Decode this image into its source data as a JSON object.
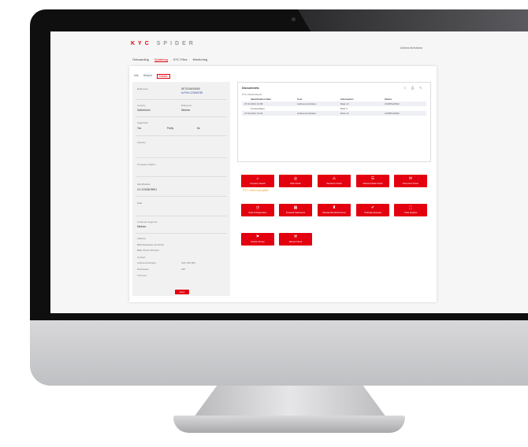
{
  "app": {
    "logo_a": "KYC",
    "logo_b": "SPIDER",
    "user": "Andrea Amistrana"
  },
  "nav": [
    "Onboarding",
    "Spidering",
    "KYC Files",
    "Monitoring"
  ],
  "subtabs": [
    "Info",
    "Search",
    "Details"
  ],
  "left": {
    "f1_label": "Reference",
    "f1_value_a": "DE70204000000",
    "f1_value_b": "ALPHA 123456789",
    "f2_label": "Country",
    "f2_value": "Switzerland",
    "f3_label": "Risk level",
    "f3_value": "Medium",
    "f4_label": "Legal form",
    "f4_opts": [
      "Yes",
      "Partly",
      "No"
    ],
    "f5_label": "Industry",
    "f6_label": "Company relation",
    "f7_label": "Identification",
    "f7_value": "CH 12345678901",
    "f8_label": "Date",
    "f9_label": "Customer segment",
    "f9_value": "Medium",
    "f10_label": "Address",
    "addr": [
      "Bahnhofstrasse 22 Zürich",
      "8001 Zürich Schweiz",
      "Contact",
      "Andrea Amistrana",
      "Employees",
      "Turnover"
    ],
    "addr_r": [
      "CHF 250 000",
      "245"
    ],
    "save": "Save"
  },
  "docs": {
    "title": "Documents",
    "toolbar": [
      "⇩",
      "⎙",
      "✎"
    ],
    "sub": "KYC Check Report",
    "headers": [
      "Identification Date",
      "User",
      "Information",
      "Status"
    ],
    "rows": [
      [
        "27.04.2021 14:08",
        "Andrea Amistrana",
        "Rate 12",
        "COMPLETED"
      ],
      [
        "",
        "",
        "Rate 3",
        ""
      ],
      [
        "27.04.2021 13:44",
        "Andrea Amistrana",
        "Rate 12",
        "COMPLETED"
      ]
    ],
    "row_links": [
      "",
      "Kundendaten",
      ""
    ]
  },
  "actions": [
    {
      "icon": "⌂",
      "label": "Company Search"
    },
    {
      "icon": "◎",
      "label": "Risk Check"
    },
    {
      "icon": "⚠",
      "label": "Sanctions Check"
    },
    {
      "icon": "☰",
      "label": "Adverse Media Check"
    },
    {
      "icon": "✉",
      "label": "Document Check"
    },
    {
      "icon": "◷",
      "label": "Date of Registration"
    },
    {
      "icon": "▦",
      "label": "Financial Statements"
    },
    {
      "icon": "♜",
      "label": "Ultimate Beneficial Owner"
    },
    {
      "icon": "✔",
      "label": "Politically Exposed"
    },
    {
      "icon": "⬚",
      "label": "Trade Register"
    },
    {
      "icon": "⚑",
      "label": "Inactive Person"
    },
    {
      "icon": "⚒",
      "label": "Manual Check"
    }
  ],
  "warning": "KYC Check incomplete",
  "colors": {
    "accent": "#e3000f",
    "link": "#3a4fa8"
  }
}
